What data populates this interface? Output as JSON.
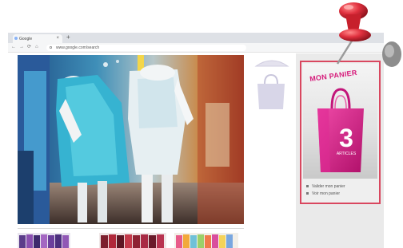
{
  "browser": {
    "tab_title": "Google",
    "tab_close": "×",
    "new_tab": "+",
    "nav": {
      "back": "←",
      "forward": "→",
      "reload": "⟳",
      "home": "⌂"
    },
    "url": "www.google.com/search"
  },
  "cart": {
    "title": "MON PANIER",
    "count": "3",
    "count_label": "ARTICLES",
    "links": [
      "Valider mon panier",
      "Voir mon panier"
    ]
  },
  "colors": {
    "accent_magenta": "#d61a7a",
    "cart_border": "#d9475f",
    "pin_red": "#e0303e"
  },
  "icons": [
    "pushpin-icon",
    "shopping-bag-icon",
    "hanger-icon",
    "lock-icon"
  ]
}
